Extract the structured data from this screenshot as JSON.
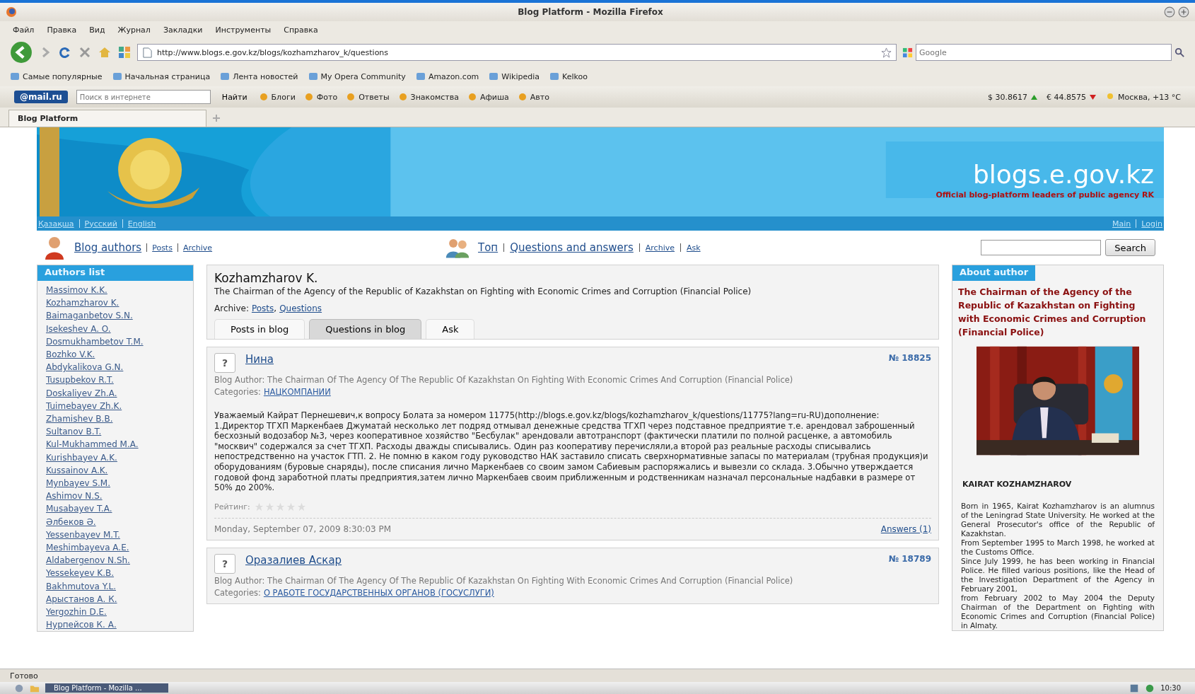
{
  "window": {
    "title": "Blog Platform - Mozilla Firefox"
  },
  "menu": [
    "Файл",
    "Правка",
    "Вид",
    "Журнал",
    "Закладки",
    "Инструменты",
    "Справка"
  ],
  "address_bar": {
    "url": "http://www.blogs.e.gov.kz/blogs/kozhamzharov_k/questions"
  },
  "web_search": {
    "placeholder": "Google"
  },
  "bookmarks": [
    "Самые популярные",
    "Начальная страница",
    "Лента новостей",
    "My Opera Community",
    "Amazon.com",
    "Wikipedia",
    "Kelkoo"
  ],
  "mail_toolbar": {
    "logo": "@mail.ru",
    "search_placeholder": "Поиск в интернете",
    "find": "Найти",
    "links": [
      "Блоги",
      "Фото",
      "Ответы",
      "Знакомства",
      "Афиша",
      "Авто"
    ],
    "rates": [
      {
        "value": "$ 30.8617",
        "rising": true
      },
      {
        "value": "€ 44.8575",
        "rising": false
      }
    ],
    "weather": "Москва, +13 °C"
  },
  "tabs": [
    {
      "label": "Blog Platform",
      "selected": true
    }
  ],
  "page": {
    "site_name": "blogs.e.gov.kz",
    "tagline": "Official blog-platform leaders of public agency RK",
    "languages": [
      "Қазақша",
      "Русский",
      "English"
    ],
    "account_links": [
      "Main",
      "Login"
    ],
    "nav_left": {
      "title": "Blog authors",
      "links": [
        "Posts",
        "Archive"
      ]
    },
    "nav_center": {
      "links": [
        "Топ",
        "Questions and answers"
      ],
      "small_links": [
        "Archive",
        "Ask"
      ]
    },
    "search_button": "Search",
    "authors_list": {
      "title": "Authors list",
      "authors": [
        "Massimov K.K.",
        "Kozhamzharov K.",
        "Baimaganbetov S.N.",
        "Isekeshev A. O.",
        "Dosmukhambetov T.M.",
        "Bozhko V.K.",
        "Abdykalikova G.N.",
        "Tusupbekov R.T.",
        "Doskaliyev Zh.A.",
        "Tuimebayev Zh.K.",
        "Zhamishev B.B.",
        "Sultanov B.T.",
        "Kul-Mukhammed M.A.",
        "Kurishbayev A.K.",
        "Kussainov A.K.",
        "Mynbayev S.M.",
        "Ashimov N.S.",
        "Musabayev T.A.",
        "Әлбеков Ә.",
        "Yessenbayev M.T.",
        "Meshimbayeva A.E.",
        "Aldabergenov N.Sh.",
        "Yessekeyev K.B.",
        "Bakhmutova Y.L.",
        "Арыстанов А. К.",
        "Yergozhin D.E.",
        "Нурпейсов К. А."
      ]
    },
    "blog": {
      "name": "Kozhamzharov K.",
      "position": "The Chairman of the Agency of the Republic of Kazakhstan on Fighting with Economic Crimes and Corruption (Financial Police)",
      "archive_label": "Archive:",
      "archive_links": [
        "Posts",
        "Questions"
      ],
      "archive_separator": ",",
      "tabs": [
        {
          "label": "Posts in blog",
          "selected": false
        },
        {
          "label": "Questions in blog",
          "selected": true
        },
        {
          "label": "Ask",
          "selected": false
        }
      ]
    },
    "questions": [
      {
        "icon": "?",
        "author": "Нина",
        "number": "№ 18825",
        "blog_author": "Blog Author: The Chairman Of The Agency Of The Republic Of Kazakhstan On Fighting With Economic Crimes And Corruption (Financial Police)",
        "categories_label": "Categories:",
        "category": "НАЦКОМПАНИИ",
        "body": "Уважаемый Кайрат Пернешевич,к вопросу Болата за номером 11775(http://blogs.e.gov.kz/blogs/kozhamzharov_k/questions/11775?lang=ru-RU)дополнение: 1.Директор ТГХП Маркенбаев Джуматай несколько лет подряд отмывал денежные средства ТГХП через подставное предприятие т.е. арендовал заброшенный бесхозный водозабор №3, через кооперативное хозяйство \"Бесбулак\" арендовали автотранспорт (фактически платили по полной расценке, а автомобиль \"москвич\" содержался за счет ТГХП. Расходы дважды списывались. Один раз кооперативу перечисляли,а второй раз реальные расходы списывались непостредственно на участок ГТП. 2. Не помню в каком году руководство НАК заставило списать сверхнормативные запасы по материалам (трубная продукция)и оборудованиям (буровые снаряды), после списания лично Маркенбаев со своим замом Сабиевым распоряжались и вывезли со склада. 3.Обычно утверждается годовой фонд заработной платы предприятия,затем лично Маркенбаев своим приближенным и родственникам назначал персональные надбавки в размере от 50% до 200%.",
        "rating_label": "Рейтинг:",
        "stars": 0,
        "date": "Monday, September 07, 2009 8:30:03 PM",
        "answers": "Answers (1)"
      },
      {
        "icon": "?",
        "author": "Оразалиев Аскар",
        "number": "№ 18789",
        "blog_author": "Blog Author: The Chairman Of The Agency Of The Republic Of Kazakhstan On Fighting With Economic Crimes And Corruption (Financial Police)",
        "categories_label": "Categories:",
        "category": "О РАБОТЕ ГОСУДАРСТВЕННЫХ ОРГАНОВ (ГОСУСЛУГИ)"
      }
    ],
    "about": {
      "title": "About author",
      "position": "The Chairman of the Agency of the Republic of Kazakhstan on Fighting with Economic Crimes and Corruption (Financial Police)",
      "name": "KAIRAT KOZHAMZHAROV",
      "bio": [
        "Born in 1965, Kairat Kozhamzharov is an alumnus of the Leningrad State University. He worked at the General Prosecutor's office of the Republic of Kazakhstan.",
        "From September 1995 to March 1998, he worked at the Customs Office.",
        "Since July 1999, he has been working in Financial Police. He filled various positions, like the Head of the Investigation Department of the Agency in February 2001,",
        "from February 2002 to May 2004 the Deputy Chairman of the Department on Fighting with Economic Crimes and Corruption (Financial Police) in Almaty."
      ]
    }
  },
  "status_bar": "Готово",
  "taskbar": {
    "task": "Blog Platform - Mozilla ...",
    "clock": "10:30"
  }
}
